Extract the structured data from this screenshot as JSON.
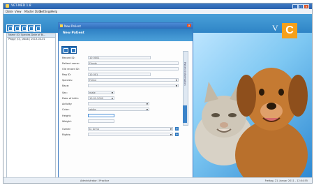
{
  "window": {
    "title": "VET-MED 1.8",
    "min": "_",
    "max": "□",
    "close": "×"
  },
  "menu": [
    "Datei",
    "View",
    "Master Data",
    "Settings",
    "Help"
  ],
  "sidebar": {
    "header": "Name (O)  Species  Date of Bi...",
    "rows": [
      "Peggy (O), Jakob | 2013-04-01"
    ]
  },
  "logo": {
    "letter": "C",
    "mark": "V",
    "color": "#f5a01a"
  },
  "dialog": {
    "title": "New Patient",
    "header": "New Patient",
    "close": "×",
    "vertical_tab": "Patient Information",
    "fields": [
      {
        "label": "Record ID:",
        "value": "10 0001"
      },
      {
        "label": "Patient name:",
        "value": "Frieda"
      },
      {
        "label": "Old record ID:",
        "value": ""
      },
      {
        "label": "Reg ID:",
        "value": "10 001"
      },
      {
        "label": "Species:",
        "value": "Feline"
      },
      {
        "label": "Race:",
        "value": ""
      },
      {
        "label": "Sex:",
        "value": "male"
      },
      {
        "label": "Date of birth:",
        "value": "10.01.2009"
      },
      {
        "label": "Activity:",
        "value": ""
      },
      {
        "label": "Color:",
        "value": "white"
      },
      {
        "label": "Height:",
        "value": ""
      },
      {
        "label": "Weight:",
        "value": ""
      },
      {
        "label": "Owner:",
        "value": "D. Anna"
      },
      {
        "label": "Rights:",
        "value": ""
      }
    ]
  },
  "status": {
    "center": "Administrator / Practice",
    "right": "Freitag, 21. Januar 2011 - 12:04:55"
  }
}
